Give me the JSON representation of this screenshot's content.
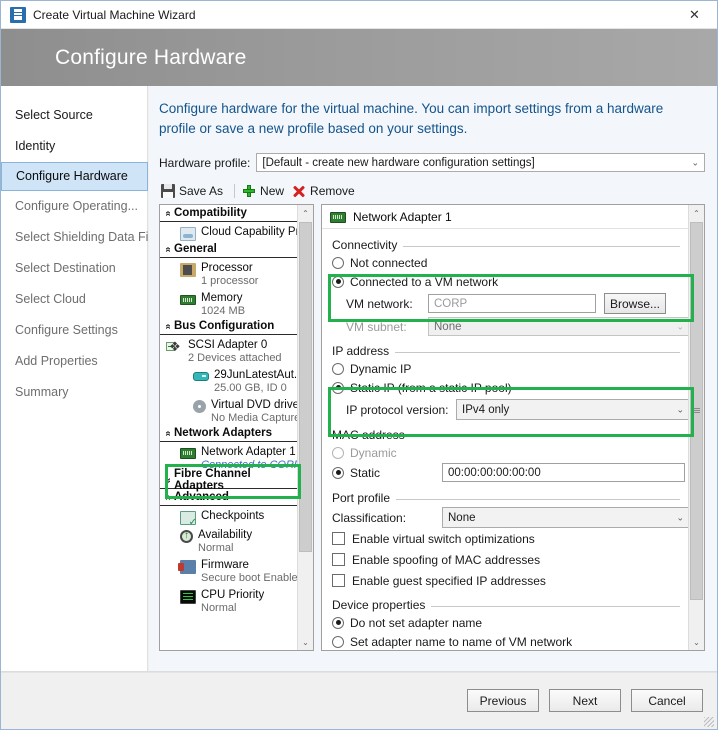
{
  "window": {
    "title": "Create Virtual Machine Wizard",
    "icon": "wizard-icon",
    "close_label": "✕"
  },
  "banner": {
    "title": "Configure Hardware"
  },
  "sidebar": {
    "items": [
      {
        "label": "Select Source",
        "state": "done"
      },
      {
        "label": "Identity",
        "state": "done"
      },
      {
        "label": "Configure Hardware",
        "state": "active"
      },
      {
        "label": "Configure Operating...",
        "state": "pending"
      },
      {
        "label": "Select Shielding Data File",
        "state": "pending"
      },
      {
        "label": "Select Destination",
        "state": "pending"
      },
      {
        "label": "Select Cloud",
        "state": "pending"
      },
      {
        "label": "Configure Settings",
        "state": "pending"
      },
      {
        "label": "Add Properties",
        "state": "pending"
      },
      {
        "label": "Summary",
        "state": "pending"
      }
    ]
  },
  "main": {
    "intro": "Configure hardware for the virtual machine. You can import settings from a hardware profile or save a new profile based on your settings.",
    "profile": {
      "label": "Hardware profile:",
      "value": "[Default - create new hardware configuration settings]"
    },
    "toolbar": {
      "save_as": "Save As",
      "new": "New",
      "remove": "Remove"
    }
  },
  "tree": {
    "groups": [
      {
        "title": "Compatibility",
        "expanded": true,
        "rows": [
          {
            "icon": "cloud-capability-icon",
            "label": "Cloud Capability Pr...",
            "sub": ""
          }
        ]
      },
      {
        "title": "General",
        "expanded": true,
        "rows": [
          {
            "icon": "processor-icon",
            "label": "Processor",
            "sub": "1 processor"
          },
          {
            "icon": "memory-icon",
            "label": "Memory",
            "sub": "1024 MB"
          }
        ]
      },
      {
        "title": "Bus Configuration",
        "expanded": true,
        "rows": [
          {
            "icon": "scsi-adapter-icon",
            "label": "SCSI Adapter 0",
            "sub": "2 Devices attached",
            "expander": true
          },
          {
            "icon": "virtual-disk-icon",
            "label": "29JunLatestAut...",
            "sub": "25.00 GB, ID 0",
            "indent": true
          },
          {
            "icon": "dvd-drive-icon",
            "label": "Virtual DVD drive",
            "sub": "No Media Captured",
            "indent": true
          }
        ]
      },
      {
        "title": "Network Adapters",
        "expanded": true,
        "rows": [
          {
            "icon": "network-adapter-icon",
            "label": "Network Adapter 1",
            "sub": "Connected to CORP",
            "sub_link": true,
            "highlight": true
          }
        ]
      },
      {
        "title": "Fibre Channel Adapters",
        "expanded": false,
        "rows": []
      },
      {
        "title": "Advanced",
        "expanded": true,
        "rows": [
          {
            "icon": "checkpoints-icon",
            "label": "Checkpoints",
            "sub": ""
          },
          {
            "icon": "availability-icon",
            "label": "Availability",
            "sub": "Normal"
          },
          {
            "icon": "firmware-icon",
            "label": "Firmware",
            "sub": "Secure boot Enabled"
          },
          {
            "icon": "cpu-priority-icon",
            "label": "CPU Priority",
            "sub": "Normal"
          }
        ]
      }
    ]
  },
  "details": {
    "header": "Network Adapter 1",
    "connectivity": {
      "group": "Connectivity",
      "not_connected": "Not connected",
      "connected": "Connected to a VM network",
      "vm_network_label": "VM network:",
      "vm_network_value": "CORP",
      "browse_button": "Browse...",
      "vm_subnet_label": "VM subnet:",
      "vm_subnet_value": "None",
      "selected": "connected"
    },
    "ip_address": {
      "group": "IP address",
      "dynamic": "Dynamic IP",
      "static": "Static IP (from a static IP pool)",
      "protocol_label": "IP protocol version:",
      "protocol_value": "IPv4 only",
      "selected": "static"
    },
    "mac_address": {
      "group": "MAC address",
      "dynamic": "Dynamic",
      "static": "Static",
      "static_value": "00:00:00:00:00:00",
      "selected": "static"
    },
    "port_profile": {
      "group": "Port profile",
      "classification_label": "Classification:",
      "classification_value": "None",
      "checkboxes": [
        {
          "label": "Enable virtual switch optimizations",
          "checked": false
        },
        {
          "label": "Enable spoofing of MAC addresses",
          "checked": false
        },
        {
          "label": "Enable guest specified IP addresses",
          "checked": false
        }
      ]
    },
    "device_properties": {
      "group": "Device properties",
      "do_not_set": "Do not set adapter name",
      "set_to_vm_network": "Set adapter name to name of VM network",
      "selected": "do_not_set"
    }
  },
  "footer": {
    "previous": "Previous",
    "next": "Next",
    "cancel": "Cancel"
  },
  "annotation": {
    "color": "#22b14c"
  }
}
